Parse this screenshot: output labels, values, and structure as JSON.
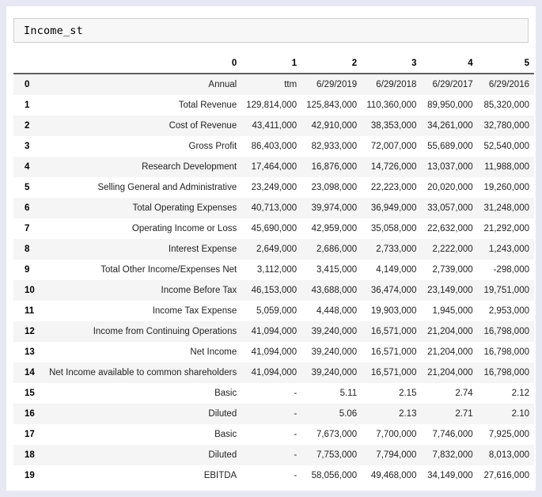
{
  "notebook": {
    "input_cell": {
      "code": "Income_st"
    }
  },
  "dataframe": {
    "index_header": "",
    "columns": [
      "0",
      "1",
      "2",
      "3",
      "4",
      "5"
    ],
    "index": [
      "0",
      "1",
      "2",
      "3",
      "4",
      "5",
      "6",
      "7",
      "8",
      "9",
      "10",
      "11",
      "12",
      "13",
      "14",
      "15",
      "16",
      "17",
      "18",
      "19"
    ],
    "rows": [
      {
        "index": "0",
        "label": "Annual",
        "values": [
          "ttm",
          "6/29/2019",
          "6/29/2018",
          "6/29/2017",
          "6/29/2016"
        ]
      },
      {
        "index": "1",
        "label": "Total Revenue",
        "values": [
          "129,814,000",
          "125,843,000",
          "110,360,000",
          "89,950,000",
          "85,320,000"
        ]
      },
      {
        "index": "2",
        "label": "Cost of Revenue",
        "values": [
          "43,411,000",
          "42,910,000",
          "38,353,000",
          "34,261,000",
          "32,780,000"
        ]
      },
      {
        "index": "3",
        "label": "Gross Profit",
        "values": [
          "86,403,000",
          "82,933,000",
          "72,007,000",
          "55,689,000",
          "52,540,000"
        ]
      },
      {
        "index": "4",
        "label": "Research Development",
        "values": [
          "17,464,000",
          "16,876,000",
          "14,726,000",
          "13,037,000",
          "11,988,000"
        ]
      },
      {
        "index": "5",
        "label": "Selling General and Administrative",
        "values": [
          "23,249,000",
          "23,098,000",
          "22,223,000",
          "20,020,000",
          "19,260,000"
        ]
      },
      {
        "index": "6",
        "label": "Total Operating Expenses",
        "values": [
          "40,713,000",
          "39,974,000",
          "36,949,000",
          "33,057,000",
          "31,248,000"
        ]
      },
      {
        "index": "7",
        "label": "Operating Income or Loss",
        "values": [
          "45,690,000",
          "42,959,000",
          "35,058,000",
          "22,632,000",
          "21,292,000"
        ]
      },
      {
        "index": "8",
        "label": "Interest Expense",
        "values": [
          "2,649,000",
          "2,686,000",
          "2,733,000",
          "2,222,000",
          "1,243,000"
        ]
      },
      {
        "index": "9",
        "label": "Total Other Income/Expenses Net",
        "values": [
          "3,112,000",
          "3,415,000",
          "4,149,000",
          "2,739,000",
          "-298,000"
        ]
      },
      {
        "index": "10",
        "label": "Income Before Tax",
        "values": [
          "46,153,000",
          "43,688,000",
          "36,474,000",
          "23,149,000",
          "19,751,000"
        ]
      },
      {
        "index": "11",
        "label": "Income Tax Expense",
        "values": [
          "5,059,000",
          "4,448,000",
          "19,903,000",
          "1,945,000",
          "2,953,000"
        ]
      },
      {
        "index": "12",
        "label": "Income from Continuing Operations",
        "values": [
          "41,094,000",
          "39,240,000",
          "16,571,000",
          "21,204,000",
          "16,798,000"
        ]
      },
      {
        "index": "13",
        "label": "Net Income",
        "values": [
          "41,094,000",
          "39,240,000",
          "16,571,000",
          "21,204,000",
          "16,798,000"
        ]
      },
      {
        "index": "14",
        "label": "Net Income available to common shareholders",
        "values": [
          "41,094,000",
          "39,240,000",
          "16,571,000",
          "21,204,000",
          "16,798,000"
        ]
      },
      {
        "index": "15",
        "label": "Basic",
        "values": [
          "-",
          "5.11",
          "2.15",
          "2.74",
          "2.12"
        ]
      },
      {
        "index": "16",
        "label": "Diluted",
        "values": [
          "-",
          "5.06",
          "2.13",
          "2.71",
          "2.10"
        ]
      },
      {
        "index": "17",
        "label": "Basic",
        "values": [
          "-",
          "7,673,000",
          "7,700,000",
          "7,746,000",
          "7,925,000"
        ]
      },
      {
        "index": "18",
        "label": "Diluted",
        "values": [
          "-",
          "7,753,000",
          "7,794,000",
          "7,832,000",
          "8,013,000"
        ]
      },
      {
        "index": "19",
        "label": "EBITDA",
        "values": [
          "-",
          "58,056,000",
          "49,468,000",
          "34,149,000",
          "27,616,000"
        ]
      }
    ]
  }
}
